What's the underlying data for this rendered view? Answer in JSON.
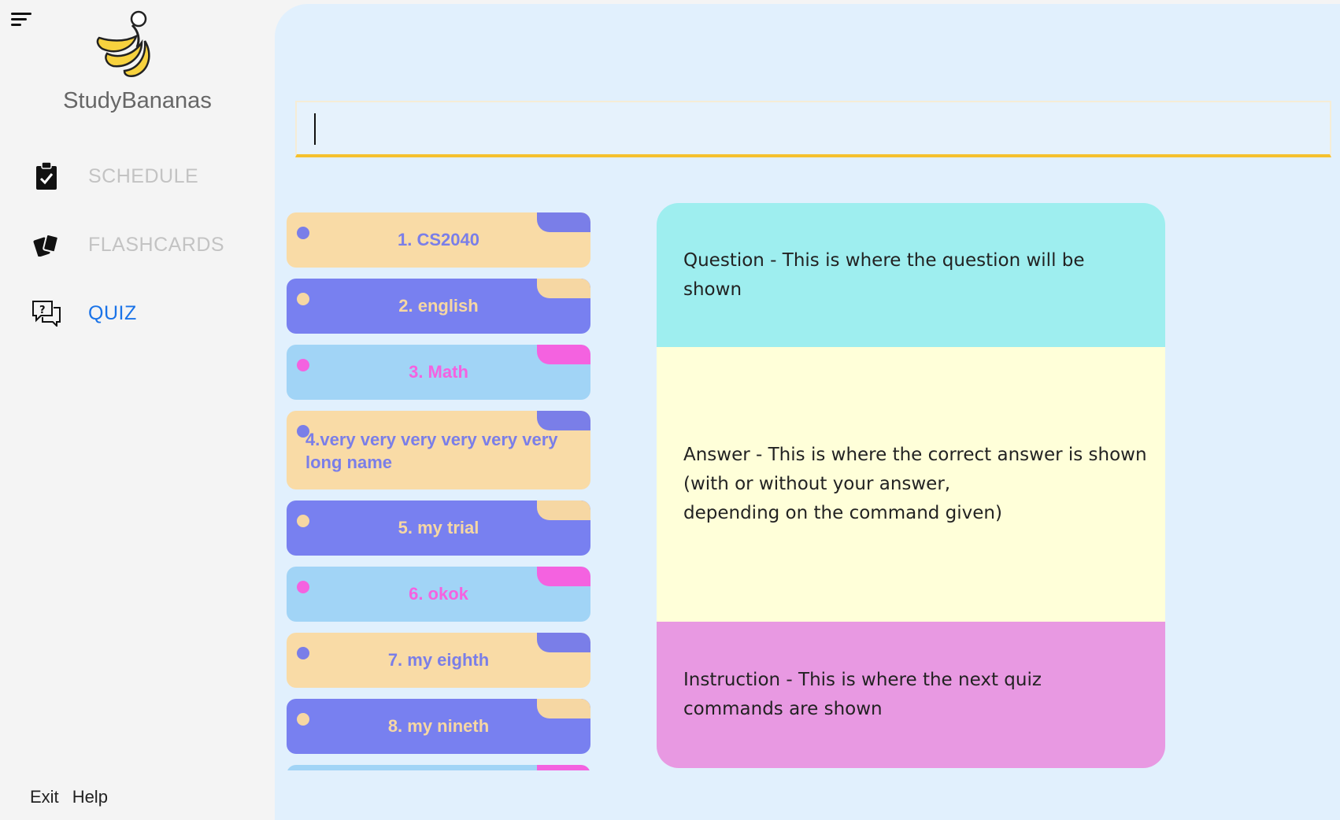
{
  "app": {
    "name": "StudyBananas"
  },
  "nav": {
    "schedule": {
      "label": "SCHEDULE",
      "icon": "clipboard-check-icon"
    },
    "flashcards": {
      "label": "FLASHCARDS",
      "icon": "cards-icon"
    },
    "quiz": {
      "label": "QUIZ",
      "icon": "chat-question-icon",
      "active": true
    }
  },
  "footer": {
    "exit": "Exit",
    "help": "Help"
  },
  "command_box": {
    "value": ""
  },
  "quiz_sets": [
    {
      "label": "1. CS2040",
      "color": "peach"
    },
    {
      "label": "2. english",
      "color": "blue"
    },
    {
      "label": "3. Math",
      "color": "sky"
    },
    {
      "label": "4.very very very very very very long name",
      "color": "peach"
    },
    {
      "label": "5. my trial",
      "color": "blue"
    },
    {
      "label": "6. okok",
      "color": "sky"
    },
    {
      "label": "7. my eighth",
      "color": "peach"
    },
    {
      "label": "8. my nineth",
      "color": "blue"
    }
  ],
  "panels": {
    "question": "Question - This is where the question will be shown",
    "answer_lines": [
      "Answer - This is where the correct answer is shown",
      "(with or without your answer,",
      "depending on the command given)"
    ],
    "instruction": "Instruction - This is where the next quiz commands are shown"
  },
  "colors": {
    "accent_yellow": "#f5c12d",
    "active_nav": "#1a73e8",
    "card_peach": "#f9dba6",
    "card_blue": "#7880f0",
    "card_sky": "#a1d4f6",
    "question_bg": "#9eeeef",
    "answer_bg": "#ffffd9",
    "instruction_bg": "#e899e2"
  }
}
